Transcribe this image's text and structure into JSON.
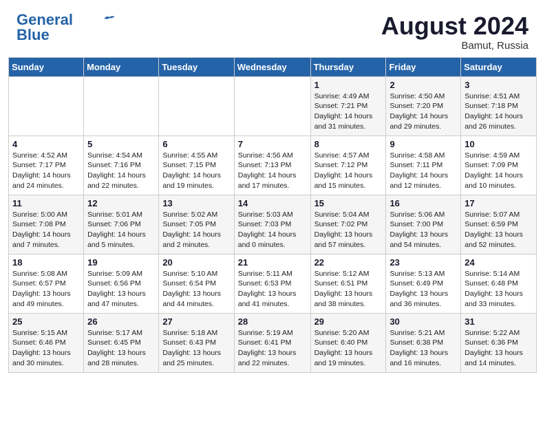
{
  "header": {
    "logo_line1": "General",
    "logo_line2": "Blue",
    "month_year": "August 2024",
    "location": "Bamut, Russia"
  },
  "weekdays": [
    "Sunday",
    "Monday",
    "Tuesday",
    "Wednesday",
    "Thursday",
    "Friday",
    "Saturday"
  ],
  "weeks": [
    [
      {
        "day": "",
        "info": ""
      },
      {
        "day": "",
        "info": ""
      },
      {
        "day": "",
        "info": ""
      },
      {
        "day": "",
        "info": ""
      },
      {
        "day": "1",
        "info": "Sunrise: 4:49 AM\nSunset: 7:21 PM\nDaylight: 14 hours\nand 31 minutes."
      },
      {
        "day": "2",
        "info": "Sunrise: 4:50 AM\nSunset: 7:20 PM\nDaylight: 14 hours\nand 29 minutes."
      },
      {
        "day": "3",
        "info": "Sunrise: 4:51 AM\nSunset: 7:18 PM\nDaylight: 14 hours\nand 26 minutes."
      }
    ],
    [
      {
        "day": "4",
        "info": "Sunrise: 4:52 AM\nSunset: 7:17 PM\nDaylight: 14 hours\nand 24 minutes."
      },
      {
        "day": "5",
        "info": "Sunrise: 4:54 AM\nSunset: 7:16 PM\nDaylight: 14 hours\nand 22 minutes."
      },
      {
        "day": "6",
        "info": "Sunrise: 4:55 AM\nSunset: 7:15 PM\nDaylight: 14 hours\nand 19 minutes."
      },
      {
        "day": "7",
        "info": "Sunrise: 4:56 AM\nSunset: 7:13 PM\nDaylight: 14 hours\nand 17 minutes."
      },
      {
        "day": "8",
        "info": "Sunrise: 4:57 AM\nSunset: 7:12 PM\nDaylight: 14 hours\nand 15 minutes."
      },
      {
        "day": "9",
        "info": "Sunrise: 4:58 AM\nSunset: 7:11 PM\nDaylight: 14 hours\nand 12 minutes."
      },
      {
        "day": "10",
        "info": "Sunrise: 4:59 AM\nSunset: 7:09 PM\nDaylight: 14 hours\nand 10 minutes."
      }
    ],
    [
      {
        "day": "11",
        "info": "Sunrise: 5:00 AM\nSunset: 7:08 PM\nDaylight: 14 hours\nand 7 minutes."
      },
      {
        "day": "12",
        "info": "Sunrise: 5:01 AM\nSunset: 7:06 PM\nDaylight: 14 hours\nand 5 minutes."
      },
      {
        "day": "13",
        "info": "Sunrise: 5:02 AM\nSunset: 7:05 PM\nDaylight: 14 hours\nand 2 minutes."
      },
      {
        "day": "14",
        "info": "Sunrise: 5:03 AM\nSunset: 7:03 PM\nDaylight: 14 hours\nand 0 minutes."
      },
      {
        "day": "15",
        "info": "Sunrise: 5:04 AM\nSunset: 7:02 PM\nDaylight: 13 hours\nand 57 minutes."
      },
      {
        "day": "16",
        "info": "Sunrise: 5:06 AM\nSunset: 7:00 PM\nDaylight: 13 hours\nand 54 minutes."
      },
      {
        "day": "17",
        "info": "Sunrise: 5:07 AM\nSunset: 6:59 PM\nDaylight: 13 hours\nand 52 minutes."
      }
    ],
    [
      {
        "day": "18",
        "info": "Sunrise: 5:08 AM\nSunset: 6:57 PM\nDaylight: 13 hours\nand 49 minutes."
      },
      {
        "day": "19",
        "info": "Sunrise: 5:09 AM\nSunset: 6:56 PM\nDaylight: 13 hours\nand 47 minutes."
      },
      {
        "day": "20",
        "info": "Sunrise: 5:10 AM\nSunset: 6:54 PM\nDaylight: 13 hours\nand 44 minutes."
      },
      {
        "day": "21",
        "info": "Sunrise: 5:11 AM\nSunset: 6:53 PM\nDaylight: 13 hours\nand 41 minutes."
      },
      {
        "day": "22",
        "info": "Sunrise: 5:12 AM\nSunset: 6:51 PM\nDaylight: 13 hours\nand 38 minutes."
      },
      {
        "day": "23",
        "info": "Sunrise: 5:13 AM\nSunset: 6:49 PM\nDaylight: 13 hours\nand 36 minutes."
      },
      {
        "day": "24",
        "info": "Sunrise: 5:14 AM\nSunset: 6:48 PM\nDaylight: 13 hours\nand 33 minutes."
      }
    ],
    [
      {
        "day": "25",
        "info": "Sunrise: 5:15 AM\nSunset: 6:46 PM\nDaylight: 13 hours\nand 30 minutes."
      },
      {
        "day": "26",
        "info": "Sunrise: 5:17 AM\nSunset: 6:45 PM\nDaylight: 13 hours\nand 28 minutes."
      },
      {
        "day": "27",
        "info": "Sunrise: 5:18 AM\nSunset: 6:43 PM\nDaylight: 13 hours\nand 25 minutes."
      },
      {
        "day": "28",
        "info": "Sunrise: 5:19 AM\nSunset: 6:41 PM\nDaylight: 13 hours\nand 22 minutes."
      },
      {
        "day": "29",
        "info": "Sunrise: 5:20 AM\nSunset: 6:40 PM\nDaylight: 13 hours\nand 19 minutes."
      },
      {
        "day": "30",
        "info": "Sunrise: 5:21 AM\nSunset: 6:38 PM\nDaylight: 13 hours\nand 16 minutes."
      },
      {
        "day": "31",
        "info": "Sunrise: 5:22 AM\nSunset: 6:36 PM\nDaylight: 13 hours\nand 14 minutes."
      }
    ]
  ]
}
